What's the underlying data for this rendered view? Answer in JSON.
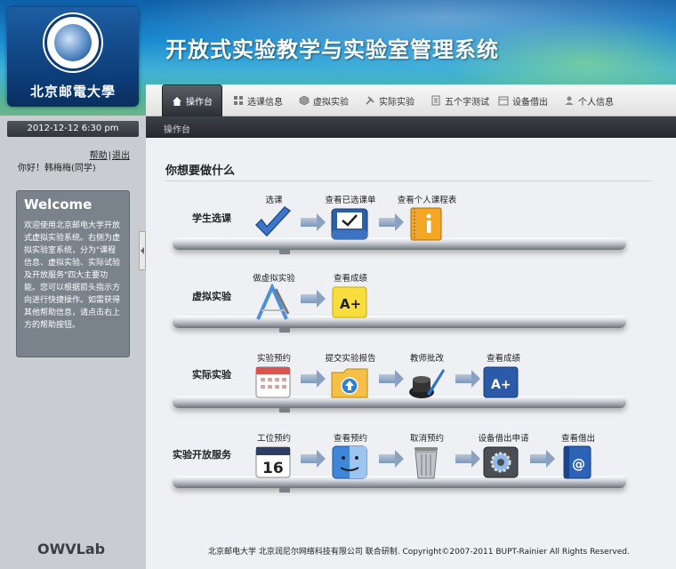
{
  "header": {
    "school_name": "北京邮電大學",
    "system_title": "开放式实验教学与实验室管理系统"
  },
  "nav": {
    "items": [
      {
        "label": "操作台",
        "icon": "home-icon",
        "active": true
      },
      {
        "label": "选课信息",
        "icon": "grid-icon",
        "active": false
      },
      {
        "label": "虚拟实验",
        "icon": "cube-icon",
        "active": false
      },
      {
        "label": "实际实验",
        "icon": "tools-icon",
        "active": false
      },
      {
        "label": "五个字测试",
        "icon": "document-icon",
        "active": false
      },
      {
        "label": "设备借出",
        "icon": "calendar-icon",
        "active": false
      },
      {
        "label": "个人信息",
        "icon": "person-icon",
        "active": false
      }
    ]
  },
  "breadcrumb": "操作台",
  "sidebar": {
    "datetime": "2012-12-12 6:30 pm",
    "help_link": "帮助",
    "separator": "|",
    "logout_link": "退出",
    "greeting": "你好！韩梅梅(同学)",
    "welcome_title": "Welcome",
    "welcome_text": "欢迎使用北京邮电大学开放式虚拟实验系统。右侧为虚拟实验室系统，分为\"课程信息、虚拟实验、实际试验及开放服务\"四大主要功能。您可以根据箭头指示方向进行快捷操作。如需获得其他帮助信息，请点击右上方的帮助按钮。",
    "brand_logo": "OWVLab"
  },
  "main": {
    "title": "你想要做什么",
    "rows": [
      {
        "label": "学生选课",
        "steps": [
          {
            "label": "选课",
            "icon": "checkmark-icon"
          },
          {
            "label": "查看已选课单",
            "icon": "inbox-tray-icon"
          },
          {
            "label": "查看个人课程表",
            "icon": "notebook-info-icon"
          }
        ]
      },
      {
        "label": "虚拟实验",
        "steps": [
          {
            "label": "做虚拟实验",
            "icon": "drafting-tools-icon"
          },
          {
            "label": "查看成绩",
            "icon": "grade-note-icon"
          }
        ]
      },
      {
        "label": "实际实验",
        "steps": [
          {
            "label": "实验预约",
            "icon": "calendar-grid-icon"
          },
          {
            "label": "提交实验报告",
            "icon": "upload-folder-icon"
          },
          {
            "label": "教师批改",
            "icon": "ink-pen-icon"
          },
          {
            "label": "查看成绩",
            "icon": "grade-note-icon"
          }
        ]
      },
      {
        "label": "实验开放服务",
        "steps": [
          {
            "label": "工位预约",
            "icon": "calendar-16-icon"
          },
          {
            "label": "查看预约",
            "icon": "finder-icon"
          },
          {
            "label": "取消预约",
            "icon": "trash-can-icon"
          },
          {
            "label": "设备借出申请",
            "icon": "settings-gear-icon"
          },
          {
            "label": "查看借出",
            "icon": "address-book-icon"
          }
        ]
      }
    ]
  },
  "footer": "北京邮电大学 北京润尼尔网络科技有限公司 联合研制. Copyright©2007-2011 BUPT-Rainier All Rights Reserved.",
  "colors": {
    "header_blue": "#1b8bd0",
    "sidebar_gray": "#c9ccd1",
    "welcome_box": "#7a828c",
    "main_bg": "#eef0f3"
  }
}
